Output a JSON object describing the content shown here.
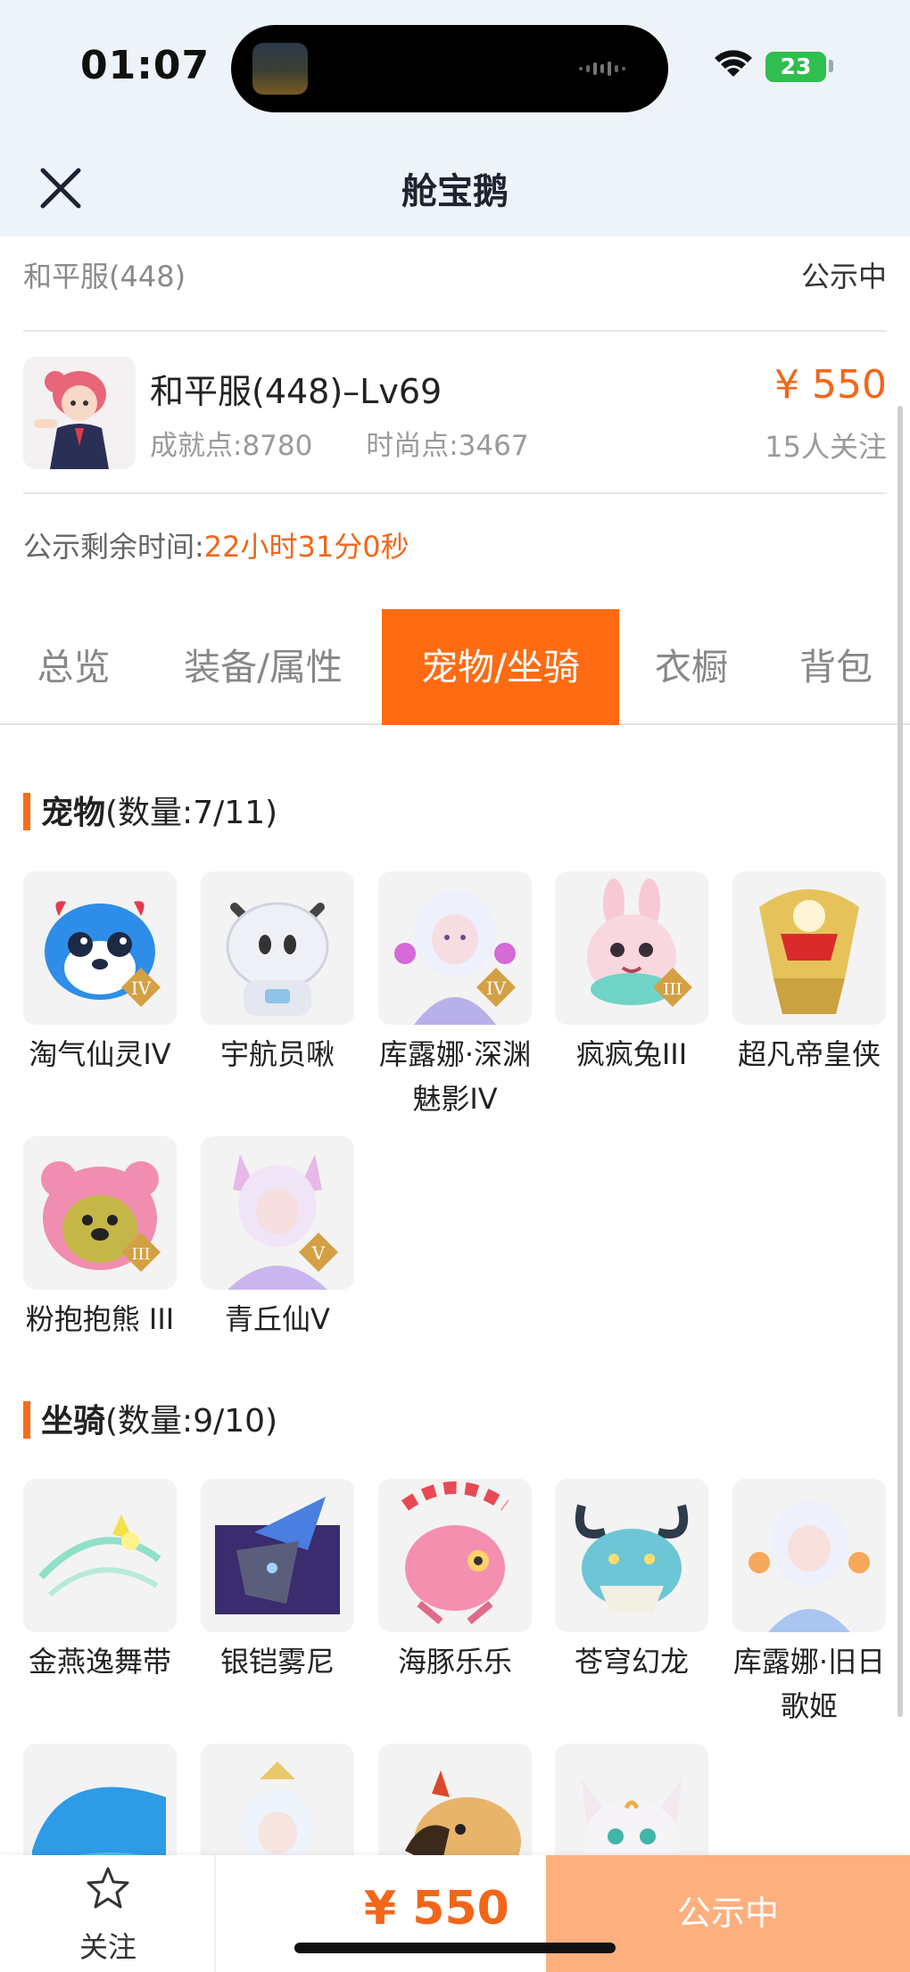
{
  "status_bar": {
    "time": "01:07",
    "battery": "23"
  },
  "header": {
    "title": "舱宝鹅"
  },
  "server": {
    "name": "和平服(448)",
    "status": "公示中"
  },
  "character": {
    "name": "和平服(448)–Lv69",
    "achievement": "成就点:8780",
    "fashion": "时尚点:3467",
    "price": "¥ 550",
    "followers": "15人关注"
  },
  "countdown": {
    "label": "公示剩余时间:",
    "value": "22小时31分0秒"
  },
  "tabs": [
    {
      "label": "总览"
    },
    {
      "label": "装备/属性"
    },
    {
      "label": "宠物/坐骑"
    },
    {
      "label": "衣橱"
    },
    {
      "label": "背包"
    }
  ],
  "pets": {
    "title": "宠物",
    "count": "(数量:7/11)",
    "items": [
      {
        "name": "淘气仙灵IV",
        "grade": "IV",
        "icon": "blue-dog-pet"
      },
      {
        "name": "宇航员啾",
        "grade": "",
        "icon": "astronaut-pet"
      },
      {
        "name": "库露娜·深渊魅影IV",
        "grade": "IV",
        "icon": "white-hair-girl-pet"
      },
      {
        "name": "疯疯兔III",
        "grade": "III",
        "icon": "pink-rabbit-pet"
      },
      {
        "name": "超凡帝皇侠",
        "grade": "",
        "icon": "golden-armor-pet"
      },
      {
        "name": "粉抱抱熊 III",
        "grade": "III",
        "icon": "pink-bear-pet"
      },
      {
        "name": "青丘仙V",
        "grade": "V",
        "icon": "fox-fairy-pet"
      }
    ]
  },
  "mounts": {
    "title": "坐骑",
    "count": "(数量:9/10)",
    "items": [
      {
        "name": "金燕逸舞带",
        "icon": "golden-swallow-mount"
      },
      {
        "name": "银铠雾尼",
        "icon": "silver-armor-mount"
      },
      {
        "name": "海豚乐乐",
        "icon": "dolphin-mount"
      },
      {
        "name": "苍穹幻龙",
        "icon": "sky-dragon-mount"
      },
      {
        "name": "库露娜·旧日歌姬",
        "icon": "singer-mount"
      },
      {
        "name": "",
        "icon": "whale-mount"
      },
      {
        "name": "",
        "icon": "fairy-mount"
      },
      {
        "name": "",
        "icon": "eagle-mount"
      },
      {
        "name": "",
        "icon": "white-cat-mount"
      }
    ]
  },
  "bottom_bar": {
    "follow_label": "关注",
    "price": "¥ 550",
    "status": "公示中"
  },
  "colors": {
    "accent": "#ff6b12",
    "price": "#f2661a",
    "status_button": "#fdaf7e"
  }
}
